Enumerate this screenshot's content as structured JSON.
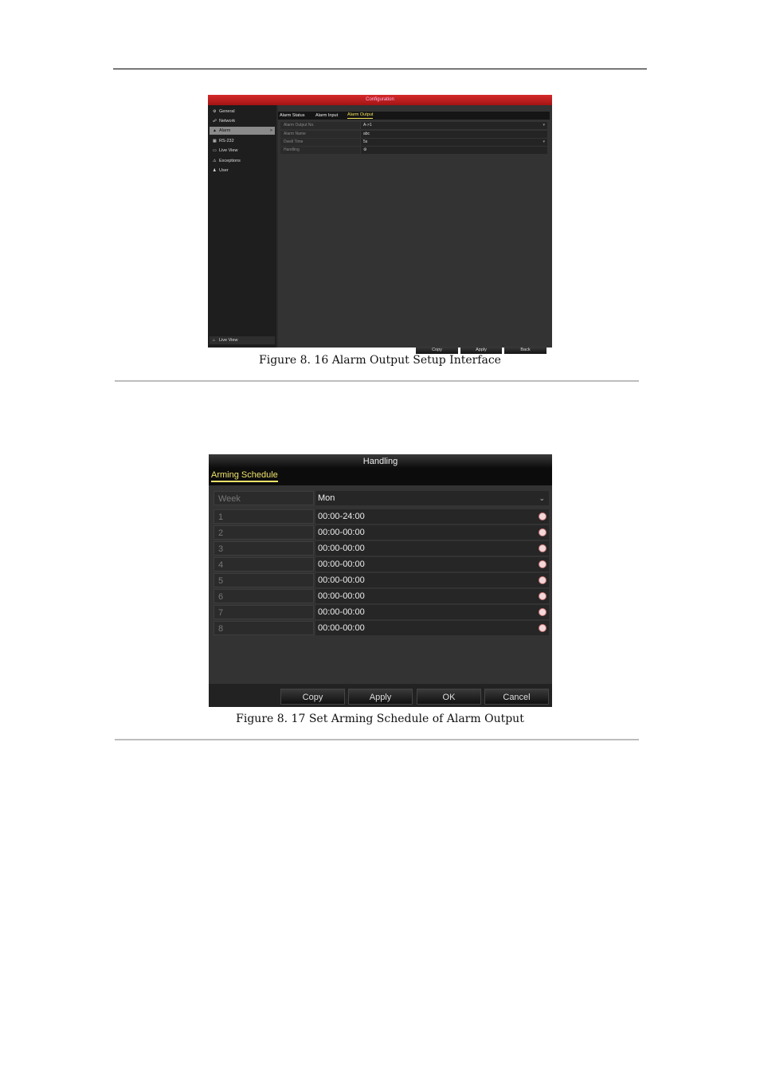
{
  "figure1": {
    "title": "Configuration",
    "sidebar": [
      {
        "label": "General",
        "icon": "gear-icon"
      },
      {
        "label": "Network",
        "icon": "network-icon"
      },
      {
        "label": "Alarm",
        "icon": "alarm-icon"
      },
      {
        "label": "RS-232",
        "icon": "rs232-icon"
      },
      {
        "label": "Live View",
        "icon": "live-view-icon"
      },
      {
        "label": "Exceptions",
        "icon": "warning-icon"
      },
      {
        "label": "User",
        "icon": "user-icon"
      }
    ],
    "selected_arrow": ">",
    "live_view_button": "Live View",
    "tabs": [
      "Alarm Status",
      "Alarm Input",
      "Alarm Output"
    ],
    "rows": [
      {
        "label": "Alarm Output No.",
        "value": "A->1"
      },
      {
        "label": "Alarm Name",
        "value": "abc"
      },
      {
        "label": "Dwell Time",
        "value": "5s"
      },
      {
        "label": "Handling",
        "value": "⚙"
      }
    ],
    "buttons": [
      "Copy",
      "Apply",
      "Back"
    ],
    "caption": "Figure 8. 16 Alarm Output Setup Interface"
  },
  "figure2": {
    "title": "Handling",
    "tab": "Arming Schedule",
    "week_label": "Week",
    "week_value": "Mon",
    "periods": [
      {
        "no": "1",
        "time": "00:00-24:00"
      },
      {
        "no": "2",
        "time": "00:00-00:00"
      },
      {
        "no": "3",
        "time": "00:00-00:00"
      },
      {
        "no": "4",
        "time": "00:00-00:00"
      },
      {
        "no": "5",
        "time": "00:00-00:00"
      },
      {
        "no": "6",
        "time": "00:00-00:00"
      },
      {
        "no": "7",
        "time": "00:00-00:00"
      },
      {
        "no": "8",
        "time": "00:00-00:00"
      }
    ],
    "buttons": [
      "Copy",
      "Apply",
      "OK",
      "Cancel"
    ],
    "caption": "Figure 8. 17 Set Arming Schedule of Alarm Output"
  },
  "colors": {
    "title_red": "#c01d1d",
    "accent_yellow": "#f0e36a"
  }
}
